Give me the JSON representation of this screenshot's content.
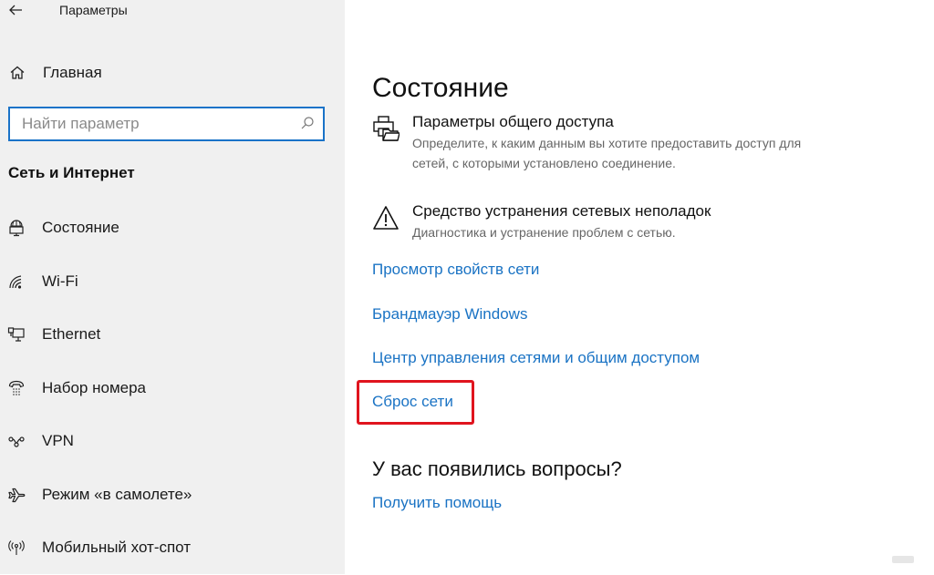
{
  "window": {
    "title": "Параметры",
    "back_icon": "arrow-left-icon"
  },
  "sidebar": {
    "home": {
      "label": "Главная",
      "icon": "home-icon"
    },
    "search": {
      "placeholder": "Найти параметр",
      "value": "",
      "icon": "search-icon"
    },
    "section_title": "Сеть и Интернет",
    "items": [
      {
        "label": "Состояние",
        "icon": "globe-monitor-icon"
      },
      {
        "label": "Wi-Fi",
        "icon": "wifi-icon"
      },
      {
        "label": "Ethernet",
        "icon": "ethernet-icon"
      },
      {
        "label": "Набор номера",
        "icon": "dialup-phone-icon"
      },
      {
        "label": "VPN",
        "icon": "vpn-icon"
      },
      {
        "label": "Режим «в самолете»",
        "icon": "airplane-icon"
      },
      {
        "label": "Мобильный хот-спот",
        "icon": "hotspot-icon"
      }
    ]
  },
  "main": {
    "title": "Состояние",
    "settings": [
      {
        "title": "Параметры общего доступа",
        "description_line1": "Определите, к каким данным вы хотите предоставить доступ для",
        "description_line2": "сетей, с которыми установлено соединение.",
        "icon": "printer-folder-icon"
      },
      {
        "title": "Средство устранения сетевых неполадок",
        "description_line1": "Диагностика и устранение проблем с сетью.",
        "icon": "warning-icon"
      }
    ],
    "links": [
      "Просмотр свойств сети",
      "Брандмауэр Windows",
      "Центр управления сетями и общим доступом",
      "Сброс сети"
    ],
    "highlighted_link": "Сброс сети",
    "help": {
      "title": "У вас появились вопросы?",
      "link": "Получить помощь"
    }
  },
  "colors": {
    "accent": "#1a73c4",
    "highlight": "#e0141e",
    "sidebar_bg": "#f0f0f0"
  }
}
